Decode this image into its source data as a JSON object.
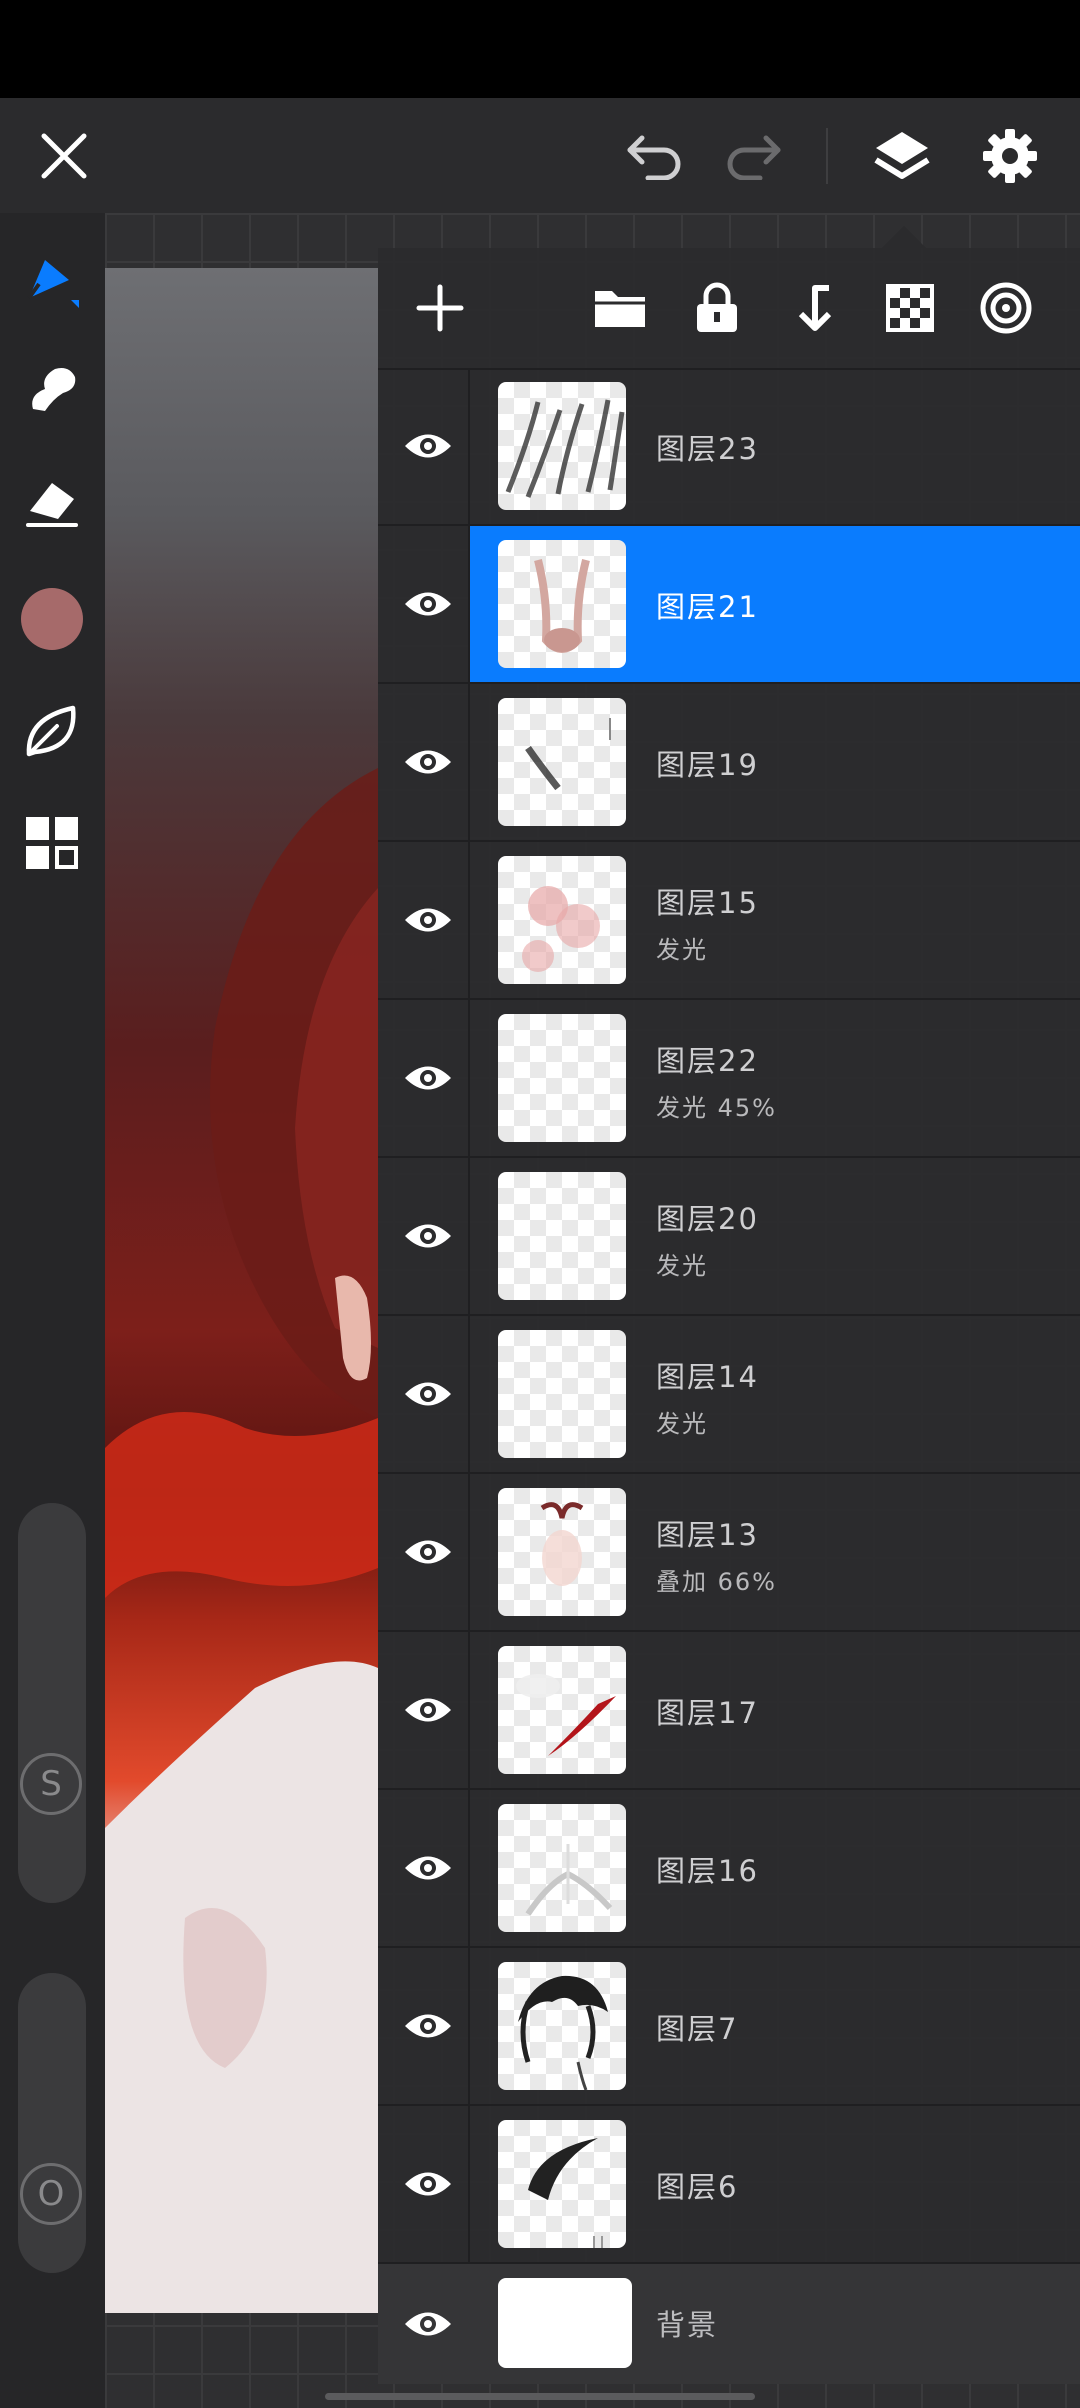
{
  "toolbar_colors": {
    "accent": "#0a7cfe",
    "current_color": "#a66a6a"
  },
  "top_bar": {
    "icons": [
      "close-icon",
      "undo-icon",
      "redo-icon",
      "layers-icon",
      "settings-icon"
    ]
  },
  "tools": {
    "icons": [
      "brush-icon",
      "smudge-icon",
      "eraser-icon",
      "color-swatch",
      "leaf-icon",
      "gallery-icon"
    ],
    "size_slider_label": "S",
    "opacity_slider_label": "O"
  },
  "layers_panel": {
    "toolbar_icons": [
      "add-layer-icon",
      "folder-icon",
      "lock-icon",
      "merge-down-icon",
      "transparency-icon",
      "target-icon"
    ],
    "layers": [
      {
        "name": "图层23",
        "blend": ""
      },
      {
        "name": "图层21",
        "blend": "",
        "selected": true
      },
      {
        "name": "图层19",
        "blend": ""
      },
      {
        "name": "图层15",
        "blend": "发光"
      },
      {
        "name": "图层22",
        "blend": "发光   45%"
      },
      {
        "name": "图层20",
        "blend": "发光"
      },
      {
        "name": "图层14",
        "blend": "发光"
      },
      {
        "name": "图层13",
        "blend": "叠加   66%"
      },
      {
        "name": "图层17",
        "blend": ""
      },
      {
        "name": "图层16",
        "blend": ""
      },
      {
        "name": "图层7",
        "blend": ""
      },
      {
        "name": "图层6",
        "blend": ""
      }
    ],
    "background_layer": {
      "name": "背景"
    }
  }
}
